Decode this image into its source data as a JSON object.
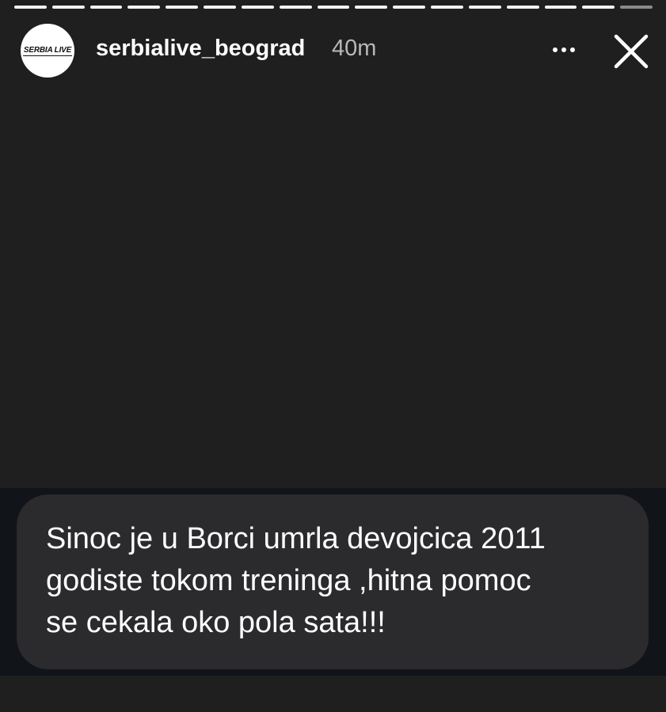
{
  "story": {
    "progress_segments": 17,
    "viewed_segments": 16
  },
  "header": {
    "avatar_logo": "SERBIA LIVE",
    "username": "serbialive_beograd",
    "time_ago": "40m",
    "more_icon": "more-horizontal-icon",
    "close_icon": "close-icon"
  },
  "message": {
    "lines": [
      "Sinoc je u Borci umrla devojcica 2011",
      "godiste tokom treninga ,hitna pomoc",
      "se cekala oko pola sata!!!"
    ]
  },
  "colors": {
    "background": "#1f1f1f",
    "band": "#111419",
    "bubble": "#2b2b2d",
    "text": "#ffffff",
    "muted_text": "#b8b8b8"
  }
}
